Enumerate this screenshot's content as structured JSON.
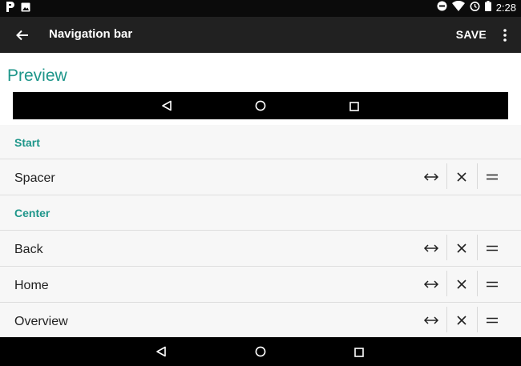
{
  "status_bar": {
    "time": "2:28",
    "left_icons": [
      "pandora-icon",
      "image-icon"
    ],
    "right_icons": [
      "do-not-disturb-icon",
      "wifi-icon",
      "alarm-icon",
      "battery-icon"
    ]
  },
  "toolbar": {
    "title": "Navigation bar",
    "save_label": "SAVE"
  },
  "preview": {
    "title": "Preview"
  },
  "sections": [
    {
      "label": "Start"
    },
    {
      "label": "Center"
    }
  ],
  "rows": [
    {
      "label": "Spacer"
    },
    {
      "label": "Back"
    },
    {
      "label": "Home"
    },
    {
      "label": "Overview"
    }
  ],
  "colors": {
    "accent": "#1e968a",
    "toolbar": "#212121",
    "status_bar": "#0b0b0b",
    "list_bg": "#f7f7f7"
  }
}
